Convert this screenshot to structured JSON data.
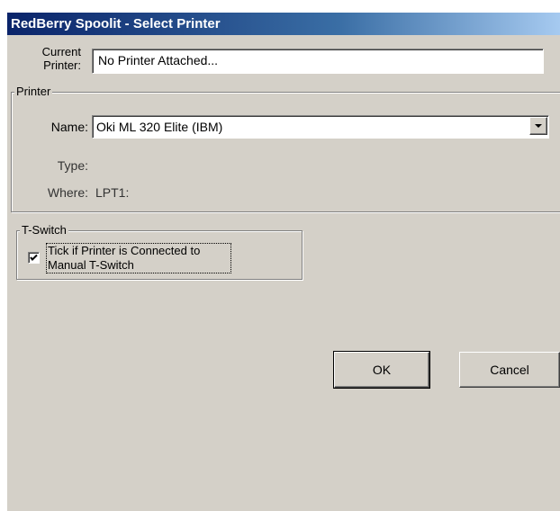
{
  "window": {
    "title": "RedBerry Spoolit - Select Printer"
  },
  "current_printer": {
    "label_line1": "Current",
    "label_line2": "Printer:",
    "value": "No Printer Attached..."
  },
  "printer_group": {
    "title": "Printer",
    "name_label": "Name:",
    "name_value": "Oki ML 320 Elite (IBM)",
    "type_label": "Type:",
    "type_value": "",
    "where_label": "Where:",
    "where_value": "LPT1:"
  },
  "tswitch_group": {
    "title": "T-Switch",
    "checkbox_line1": "Tick if Printer is Connected to",
    "checkbox_line2": "Manual T-Switch",
    "checked": true
  },
  "buttons": {
    "ok": "OK",
    "cancel": "Cancel"
  },
  "icons": {
    "dropdown": "chevron-down-icon",
    "check": "check-icon"
  }
}
